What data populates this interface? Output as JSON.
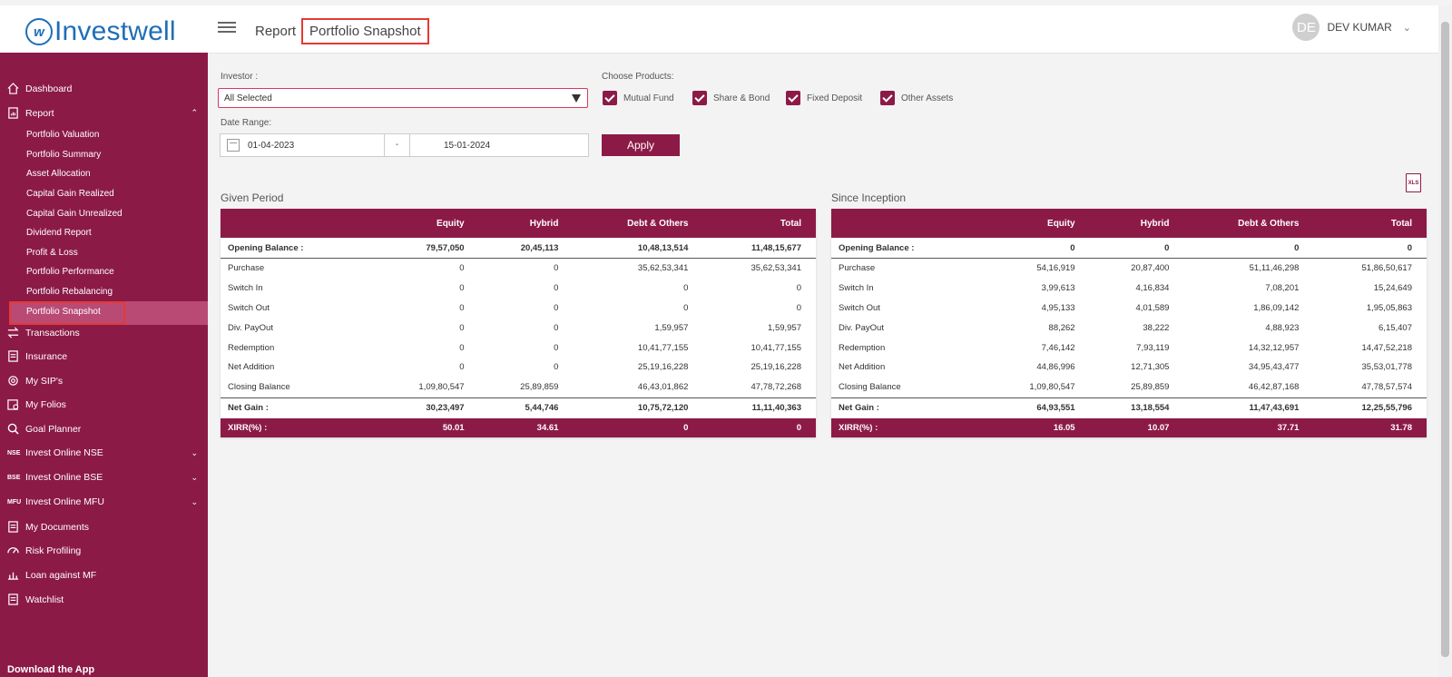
{
  "header": {
    "logo_mark": "w",
    "logo_text": "Investwell",
    "breadcrumb_parent": "Report",
    "breadcrumb_sep": "/",
    "breadcrumb_current": "Portfolio Snapshot",
    "user_initials": "DE",
    "user_name": "DEV KUMAR"
  },
  "sidebar": {
    "dashboard": "Dashboard",
    "report": "Report",
    "report_items": [
      "Portfolio Valuation",
      "Portfolio Summary",
      "Asset Allocation",
      "Capital Gain Realized",
      "Capital Gain Unrealized",
      "Dividend Report",
      "Profit & Loss",
      "Portfolio Performance",
      "Portfolio Rebalancing",
      "Portfolio Snapshot"
    ],
    "transactions": "Transactions",
    "insurance": "Insurance",
    "my_sips": "My SIP's",
    "my_folios": "My Folios",
    "goal_planner": "Goal Planner",
    "nse_tag": "NSE",
    "invest_nse": "Invest Online NSE",
    "bse_tag": "BSE",
    "invest_bse": "Invest Online BSE",
    "mfu_tag": "MFU",
    "invest_mfu": "Invest Online MFU",
    "my_documents": "My Documents",
    "risk_profiling": "Risk Profiling",
    "loan_mf": "Loan against MF",
    "watchlist": "Watchlist",
    "download": "Download the App"
  },
  "filters": {
    "investor_label": "Investor :",
    "investor_value": "All Selected",
    "products_label": "Choose Products:",
    "products": [
      "Mutual Fund",
      "Share & Bond",
      "Fixed Deposit",
      "Other Assets"
    ],
    "date_label": "Date Range:",
    "date_from": "01-04-2023",
    "date_sep": "-",
    "date_to": "15-01-2024",
    "apply": "Apply",
    "xls": "XLS"
  },
  "columns": [
    "",
    "Equity",
    "Hybrid",
    "Debt & Others",
    "Total"
  ],
  "given_period": {
    "title": "Given Period",
    "rows": [
      [
        "Opening Balance :",
        "79,57,050",
        "20,45,113",
        "10,48,13,514",
        "11,48,15,677"
      ],
      [
        "Purchase",
        "0",
        "0",
        "35,62,53,341",
        "35,62,53,341"
      ],
      [
        "Switch In",
        "0",
        "0",
        "0",
        "0"
      ],
      [
        "Switch Out",
        "0",
        "0",
        "0",
        "0"
      ],
      [
        "Div. PayOut",
        "0",
        "0",
        "1,59,957",
        "1,59,957"
      ],
      [
        "Redemption",
        "0",
        "0",
        "10,41,77,155",
        "10,41,77,155"
      ],
      [
        "Net Addition",
        "0",
        "0",
        "25,19,16,228",
        "25,19,16,228"
      ],
      [
        "Closing Balance",
        "1,09,80,547",
        "25,89,859",
        "46,43,01,862",
        "47,78,72,268"
      ],
      [
        "Net Gain :",
        "30,23,497",
        "5,44,746",
        "10,75,72,120",
        "11,11,40,363"
      ],
      [
        "XIRR(%) :",
        "50.01",
        "34.61",
        "0",
        "0"
      ]
    ]
  },
  "since_inception": {
    "title": "Since Inception",
    "rows": [
      [
        "Opening Balance :",
        "0",
        "0",
        "0",
        "0"
      ],
      [
        "Purchase",
        "54,16,919",
        "20,87,400",
        "51,11,46,298",
        "51,86,50,617"
      ],
      [
        "Switch In",
        "3,99,613",
        "4,16,834",
        "7,08,201",
        "15,24,649"
      ],
      [
        "Switch Out",
        "4,95,133",
        "4,01,589",
        "1,86,09,142",
        "1,95,05,863"
      ],
      [
        "Div. PayOut",
        "88,262",
        "38,222",
        "4,88,923",
        "6,15,407"
      ],
      [
        "Redemption",
        "7,46,142",
        "7,93,119",
        "14,32,12,957",
        "14,47,52,218"
      ],
      [
        "Net Addition",
        "44,86,996",
        "12,71,305",
        "34,95,43,477",
        "35,53,01,778"
      ],
      [
        "Closing Balance",
        "1,09,80,547",
        "25,89,859",
        "46,42,87,168",
        "47,78,57,574"
      ],
      [
        "Net Gain :",
        "64,93,551",
        "13,18,554",
        "11,47,43,691",
        "12,25,55,796"
      ],
      [
        "XIRR(%) :",
        "16.05",
        "10.07",
        "37.71",
        "31.78"
      ]
    ]
  }
}
